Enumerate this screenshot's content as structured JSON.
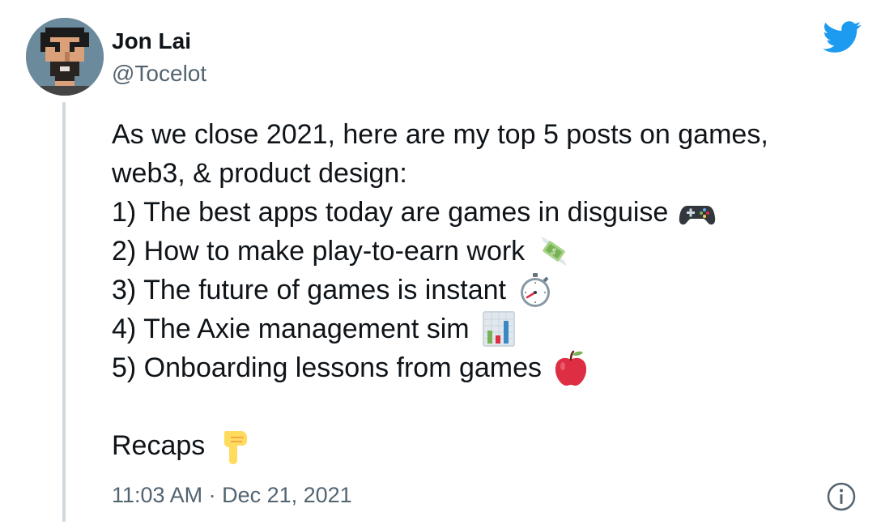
{
  "author": {
    "name": "Jon Lai",
    "handle": "@Tocelot"
  },
  "tweet": {
    "intro_line1": "As we close 2021, here are my top 5 posts on games,",
    "intro_line2": "web3, & product design:",
    "items": [
      {
        "text": "1) The best apps today are games in disguise",
        "emoji": "game-controller-icon"
      },
      {
        "text": "2) How to make play-to-earn work",
        "emoji": "money-with-wings-icon"
      },
      {
        "text": "3) The future of games is instant",
        "emoji": "stopwatch-icon"
      },
      {
        "text": "4) The Axie management sim",
        "emoji": "bar-chart-icon"
      },
      {
        "text": "5) Onboarding lessons from games",
        "emoji": "red-apple-icon"
      }
    ],
    "recaps": "Recaps",
    "recaps_emoji": "pointing-down-icon"
  },
  "footer": {
    "timestamp": "11:03 AM · Dec 21, 2021"
  },
  "colors": {
    "twitter_blue": "#1d9bf0",
    "text_primary": "#0f1419",
    "text_secondary": "#536471",
    "thread_line": "#cfd9de"
  }
}
